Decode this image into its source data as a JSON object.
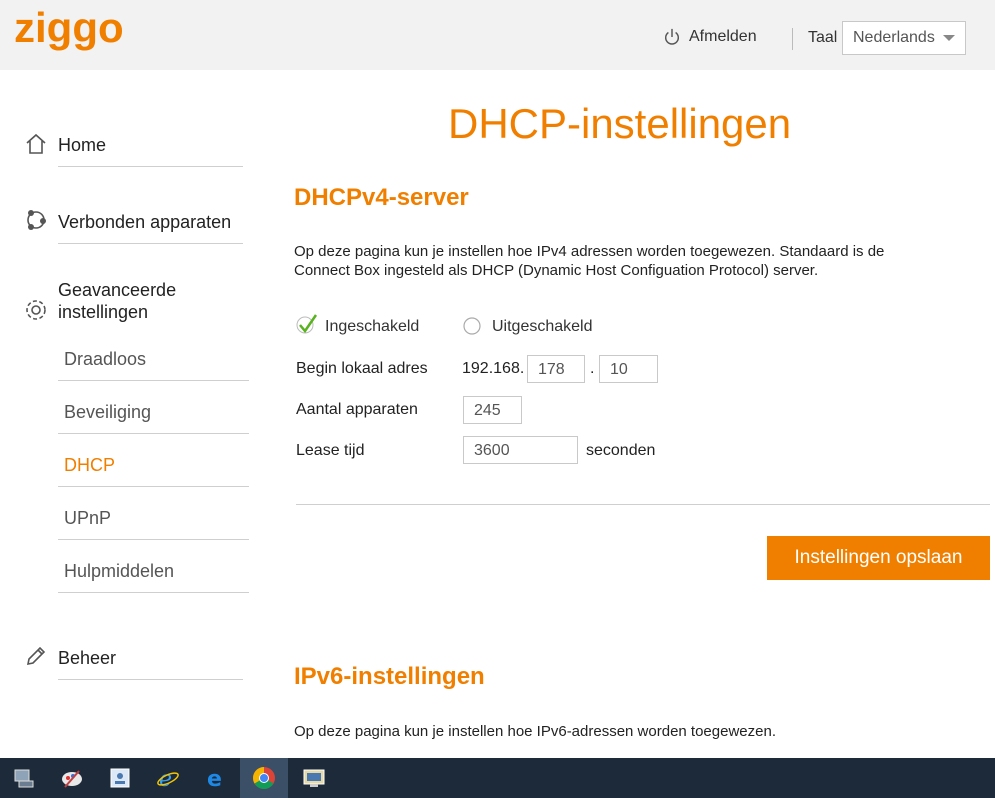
{
  "header": {
    "logo_text": "ziggo",
    "logout_label": "Afmelden",
    "language_label": "Taal",
    "language_selected": "Nederlands"
  },
  "sidebar": {
    "home": "Home",
    "devices": "Verbonden apparaten",
    "advanced_line1": "Geavanceerde",
    "advanced_line2": "instellingen",
    "sub_items": [
      "Draadloos",
      "Beveiliging",
      "DHCP",
      "UPnP",
      "Hulpmiddelen"
    ],
    "manage": "Beheer"
  },
  "main": {
    "page_title": "DHCP-instellingen",
    "v4_title": "DHCPv4-server",
    "v4_desc_line1": "Op deze pagina kun je instellen hoe IPv4 adressen worden toegewezen. Standaard is de",
    "v4_desc_line2": "Connect Box ingesteld als DHCP (Dynamic Host Configuation Protocol) server.",
    "enabled_label": "Ingeschakeld",
    "disabled_label": "Uitgeschakeld",
    "start_address_label": "Begin lokaal adres",
    "ip_prefix": "192.168.",
    "ip_octet3": "178",
    "ip_dot": ".",
    "ip_octet4": "10",
    "device_count_label": "Aantal apparaten",
    "device_count": "245",
    "lease_label": "Lease tijd",
    "lease_value": "3600",
    "lease_unit": "seconden",
    "save_label": "Instellingen opslaan",
    "v6_title": "IPv6-instellingen",
    "v6_desc": "Op deze pagina kun je instellen hoe IPv6-adressen worden toegewezen."
  },
  "colors": {
    "accent": "#f07f00",
    "header_bg": "#f2f2f2",
    "taskbar_bg": "#1c2a3a"
  }
}
